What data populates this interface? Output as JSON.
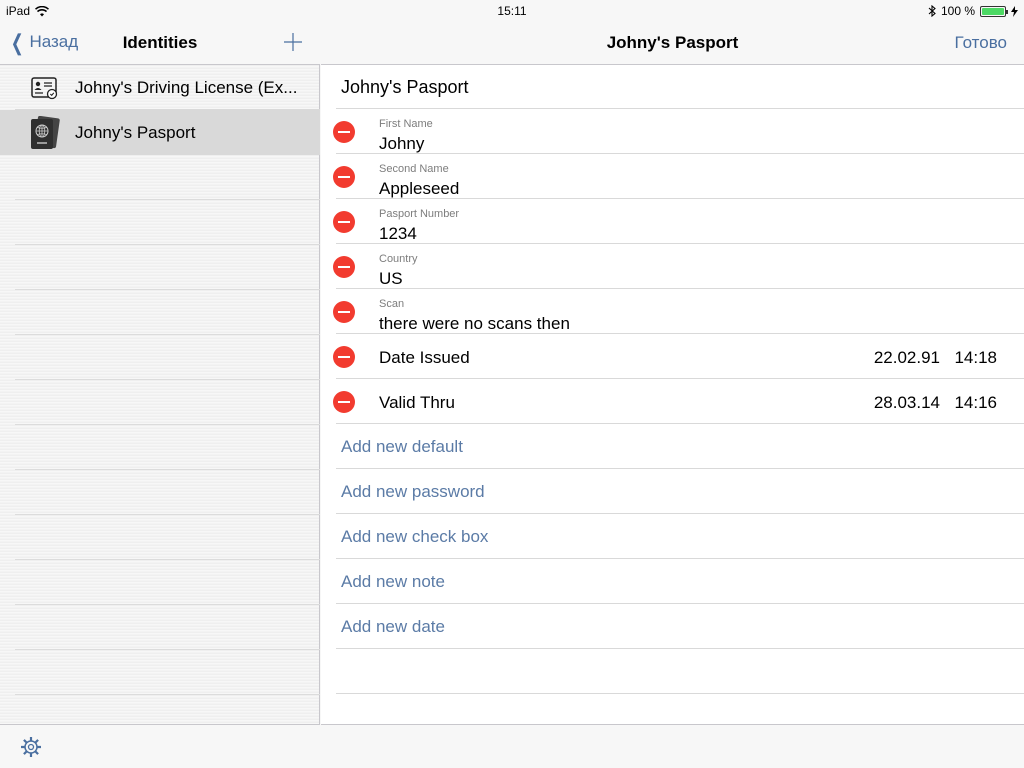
{
  "status": {
    "device": "iPad",
    "time": "15:11",
    "battery": "100 %",
    "battery_level": 1.0
  },
  "sidebar": {
    "back_label": "Назад",
    "title": "Identities",
    "items": [
      {
        "label": "Johny's Driving License (Ex...",
        "icon": "id-card-icon",
        "selected": false
      },
      {
        "label": "Johny's Pasport",
        "icon": "passport-icon",
        "selected": true
      }
    ]
  },
  "detail": {
    "nav_title": "Johny's Pasport",
    "done_label": "Готово",
    "record_title": "Johny's Pasport",
    "fields": [
      {
        "label": "First Name",
        "value": "Johny"
      },
      {
        "label": "Second Name",
        "value": "Appleseed"
      },
      {
        "label": "Pasport Number",
        "value": "1234"
      },
      {
        "label": "Country",
        "value": "US"
      },
      {
        "label": "Scan",
        "value": "there were no scans then"
      }
    ],
    "dates": [
      {
        "label": "Date Issued",
        "date": "22.02.91",
        "time": "14:18"
      },
      {
        "label": "Valid Thru",
        "date": "28.03.14",
        "time": "14:16"
      }
    ],
    "add_actions": [
      "Add new default",
      "Add new password",
      "Add new check box",
      "Add new note",
      "Add new date"
    ]
  },
  "colors": {
    "accent": "#4a6fa0",
    "delete": "#f23b2f",
    "selected_row": "#d9d9d9"
  }
}
